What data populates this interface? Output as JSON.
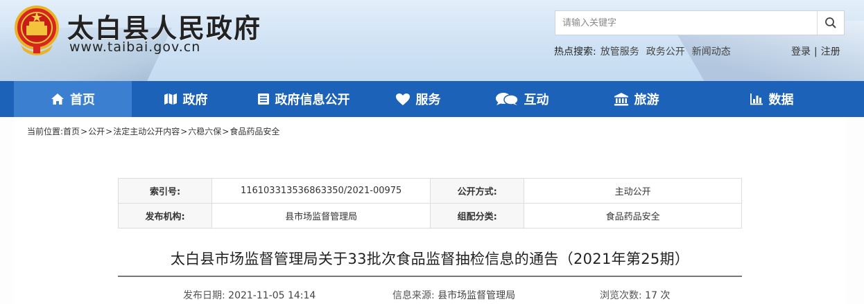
{
  "header": {
    "site_title": "太白县人民政府",
    "site_url": "www.taibai.gov.cn",
    "search_placeholder": "请输入关键字",
    "hot_search_label": "热点搜索:",
    "hot_links": [
      "放管服务",
      "政务公开",
      "新闻动态"
    ],
    "login": "登录",
    "auth_sep": "|",
    "register": "注册"
  },
  "nav": [
    {
      "label": "首页",
      "icon": "home-icon",
      "active": true
    },
    {
      "label": "政府",
      "icon": "map-icon"
    },
    {
      "label": "政府信息公开",
      "icon": "list-icon"
    },
    {
      "label": "服务",
      "icon": "heart-icon"
    },
    {
      "label": "互动",
      "icon": "chat-icon"
    },
    {
      "label": "旅游",
      "icon": "landmark-icon"
    },
    {
      "label": "数据",
      "icon": "bar-chart-icon"
    }
  ],
  "breadcrumb": {
    "prefix": "当前位置:",
    "items": [
      "首页",
      "公开",
      "法定主动公开内容",
      "六稳六保",
      "食品药品安全"
    ],
    "sep": ">"
  },
  "meta": {
    "index_label": "索引号:",
    "index_value": "116103313536863350/2021-00975",
    "open_mode_label": "公开方式:",
    "open_mode_value": "主动公开",
    "publisher_label": "发布机构:",
    "publisher_value": "县市场监督管理局",
    "category_label": "组配分类:",
    "category_value": "食品药品安全"
  },
  "article": {
    "title": "太白县市场监督管理局关于33批次食品监督抽检信息的通告（2021年第25期）",
    "date_label": "发布日期:",
    "date_value": "2021-11-05 14:14",
    "source_label": "信息来源:",
    "source_value": "县市场监督管理局",
    "views_label": "浏览次数:",
    "views_value": "17 次"
  },
  "colors": {
    "nav_bg": "#1c62b9",
    "nav_active": "#3a7fd0"
  }
}
